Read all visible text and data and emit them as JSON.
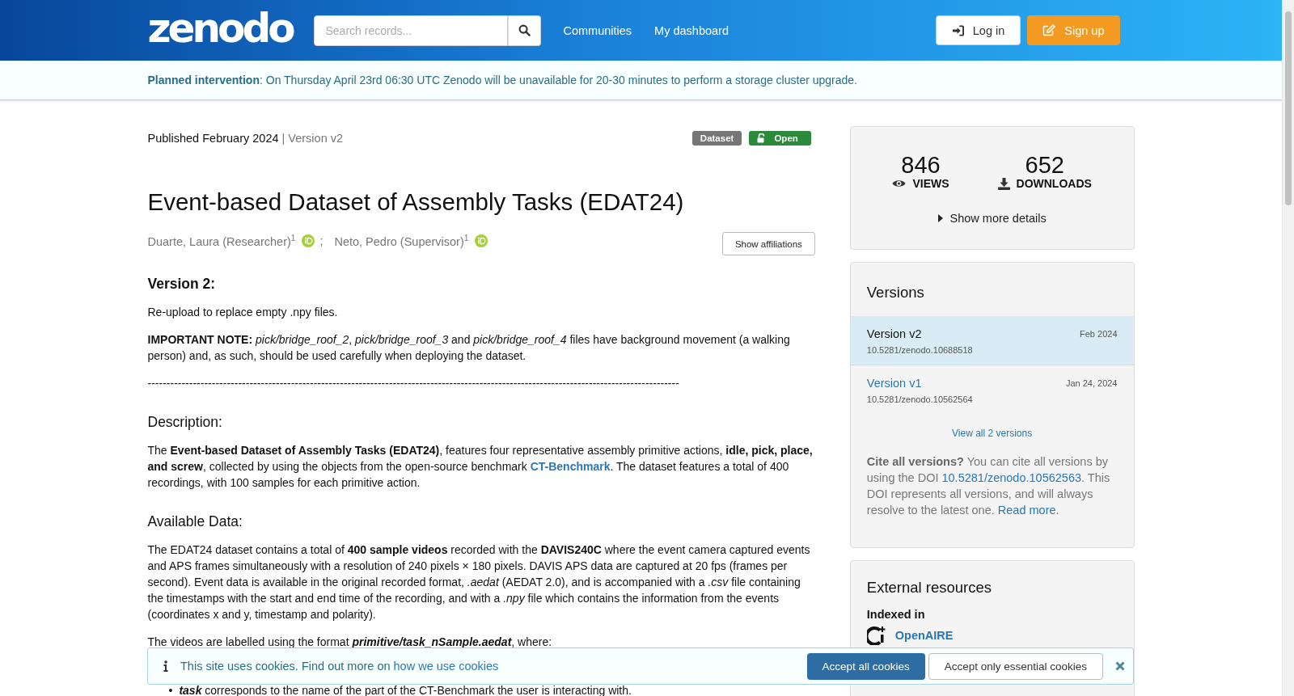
{
  "header": {
    "logo": "zenodo",
    "search": {
      "placeholder": "Search records..."
    },
    "nav": [
      "Communities",
      "My dashboard"
    ],
    "buttons": [
      {
        "label": "Log in",
        "kind": "login"
      },
      {
        "label": "Sign up",
        "kind": "signup"
      }
    ]
  },
  "banner": {
    "title": "Planned intervention",
    "text": ": On Thursday April 23rd 06:30 UTC Zenodo will be unavailable for 20-30 minutes to perform a storage cluster upgrade."
  },
  "record": {
    "published": "Published February 2024",
    "version": "| Version v2",
    "badges": [
      {
        "label": "Dataset",
        "kind": "type"
      },
      {
        "label": "Open",
        "kind": "access"
      }
    ],
    "title": "Event-based Dataset of Assembly Tasks (EDAT24)",
    "creators": [
      {
        "name": "Duarte, Laura (Researcher)$^{1}$",
        "separator": ";"
      },
      {
        "name": "Neto, Pedro (Supervisor)$^{1}$"
      }
    ],
    "affiliations_button": "Show affiliations",
    "description": [
      {
        "kind": "h3",
        "text": "Version 2:"
      },
      {
        "kind": "p",
        "parts": [
          {
            "kind": "text",
            "text": "Re-upload to replace empty .npy files."
          }
        ]
      },
      {
        "kind": "p",
        "parts": [
          {
            "kind": "text",
            "text": "**IMPORTANT NOTE:** *pick/bridge_roof_2*, *pick/bridge_roof_3* and *pick/bridge_roof_4* files have background movement (a walking person) and, as such, should be used carefully when deploying the dataset."
          }
        ]
      },
      {
        "kind": "p",
        "parts": [
          {
            "kind": "text",
            "text": "---------------------------------------------------------------------------------------------------------------------------------------------"
          }
        ]
      },
      {
        "kind": "h4",
        "text": "Description:"
      },
      {
        "kind": "p",
        "parts": [
          {
            "kind": "text",
            "text": "The **Event-based Dataset of Assembly Tasks (EDAT24)**, features four representative assembly primitive actions, **idle, pick, place, and screw**, collected by using the objects from the open-source benchmark "
          },
          {
            "kind": "link",
            "text": "CT-Benchmark"
          },
          {
            "kind": "text",
            "text": ". The dataset features a total of 400 recordings, with 100 samples for each primitive action."
          }
        ]
      },
      {
        "kind": "h4",
        "text": "Available Data:"
      },
      {
        "kind": "p",
        "parts": [
          {
            "kind": "text",
            "text": "The EDAT24 dataset contains a total of **400 sample videos** recorded with the **DAVIS240C** where the event camera captured events and APS frames simultaneously with a resolution of 240 pixels × 180 pixels. DAVIS APS data are captured at 20 fps (frames per second). Event data is available in the original recorded format, *.aedat* (AEDAT 2.0), and is accompanied with a *.csv* file containing the timestamps with the start and end time of the recording, and with a *.npy* file which contains the information from the events (coordinates x and y, timestamp and polarity)."
          }
        ]
      },
      {
        "kind": "p",
        "parts": [
          {
            "kind": "text",
            "text": "The videos are labelled using the format "
          },
          {
            "kind": "emph",
            "text": "primitive/task_nSample.aedat"
          },
          {
            "kind": "text",
            "text": ", where:"
          }
        ]
      },
      {
        "kind": "list",
        "marker": "•",
        "items": [
          [
            {
              "kind": "emph",
              "text": "task"
            },
            {
              "kind": "text",
              "text": " corresponds to the name of the part of the CT-Benchmark the user is interacting with."
            }
          ]
        ]
      }
    ]
  },
  "stats": {
    "items": [
      {
        "value": "846",
        "label": "VIEWS",
        "kind": "views"
      },
      {
        "value": "652",
        "label": "DOWNLOADS",
        "kind": "downloads"
      }
    ],
    "more_details": "Show more details"
  },
  "versions": {
    "title": "Versions",
    "items": [
      {
        "label": "Version v2",
        "date": "Feb 2024",
        "doi": "10.5281/zenodo.10688518",
        "selected": true
      },
      {
        "label": "Version v1",
        "date": "Jan 24, 2024",
        "doi": "10.5281/zenodo.10562564",
        "selected": false
      }
    ],
    "view_all": "View all 2 versions",
    "cite": [
      {
        "kind": "text",
        "text": "**Cite all versions?** You can cite all versions by using the DOI "
      },
      {
        "kind": "link",
        "text": "10.5281/zenodo.10562563"
      },
      {
        "kind": "text",
        "text": ". This DOI represents all versions, and will always resolve to the latest one. "
      },
      {
        "kind": "link",
        "text": "Read more"
      },
      {
        "kind": "text",
        "text": "."
      }
    ]
  },
  "external": {
    "title": "External resources",
    "indexed_in": "Indexed in",
    "items": [
      {
        "name": "OpenAIRE"
      }
    ]
  },
  "cookies": {
    "parts": [
      {
        "kind": "text",
        "text": "This site uses cookies. Find out more on "
      },
      {
        "kind": "link",
        "text": "how we use cookies"
      }
    ],
    "buttons": [
      {
        "label": "Accept all cookies",
        "kind": "primary"
      },
      {
        "label": "Accept only essential cookies",
        "kind": "secondary"
      }
    ]
  }
}
